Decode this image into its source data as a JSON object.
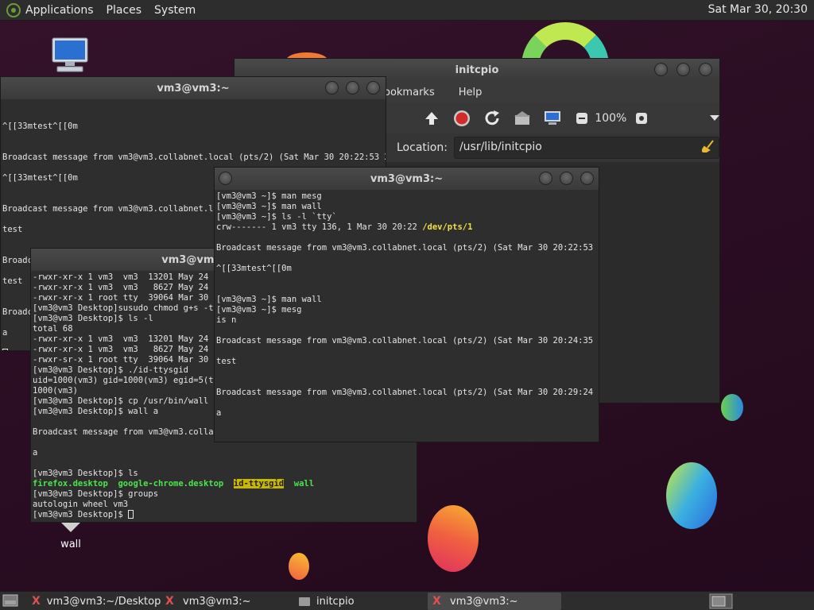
{
  "top_panel": {
    "menus": [
      "Applications",
      "Places",
      "System"
    ],
    "clock": "Sat Mar 30, 20:30"
  },
  "desktop_icons": {
    "wall_label": "wall"
  },
  "file_manager": {
    "title": "initcpio",
    "menu_bookmarks": "ookmarks",
    "menu_help": "Help",
    "zoom": "100%",
    "location_label": "Location:",
    "location_value": "/usr/lib/initcpio"
  },
  "term_back": {
    "title": "vm3@vm3:~",
    "lines": [
      "",
      "",
      "^[[33mtest^[[0m",
      "",
      "",
      "Broadcast message from vm3@vm3.collabnet.local (pts/2) (Sat Mar 30 20:22:53 202",
      "",
      "^[[33mtest^[[0m",
      "",
      "",
      "Broadcast message from vm3@vm3.collabnet.local (pts/2) (Sat Mar 30 20:24:35 202",
      "",
      "test",
      "",
      "",
      "Broadcast message from vm3@vm3.collabnet.local (pts/2) (Sat Mar 30 20:29:24 202",
      "",
      "test",
      "",
      "",
      "Broadcast message from vm3@vm3.collabnet.local (pts/2) (Sat Mar 30 20:29:24 202",
      "",
      "a",
      ""
    ]
  },
  "term_desktop": {
    "title": "vm3@vm3:~/Desktop",
    "lines": [
      "-rwxr-xr-x 1 vm3  vm3  13201 May 24  20",
      "-rwxr-xr-x 1 vm3  vm3   8627 May 24  20",
      "-rwxr-xr-x 1 root tty  39064 Mar 30 20:",
      "[vm3@vm3 Desktop]susudo chmod g+s -tty",
      "[vm3@vm3 Desktop]$ ls -l",
      "total 68",
      "-rwxr-xr-x 1 vm3  vm3  13201 May 24  20",
      "-rwxr-xr-x 1 vm3  vm3   8627 May 24  20",
      "-rwxr-sr-x 1 root tty  39064 Mar 30 20:",
      "[vm3@vm3 Desktop]$ ./id-ttysgid",
      "uid=1000(vm3) gid=1000(vm3) egid=5(tty",
      "1000(vm3)",
      "[vm3@vm3 Desktop]$ cp /usr/bin/wall .",
      "[vm3@vm3 Desktop]$ wall a",
      "",
      "Broadcast message from vm3@vm3.collabn",
      "",
      "a",
      "",
      "[vm3@vm3 Desktop]$ ls"
    ],
    "ls_files": [
      "firefox.desktop",
      "google-chrome.desktop",
      "id-ttysgid",
      "wall"
    ],
    "after_lines": [
      "[vm3@vm3 Desktop]$ groups",
      "autologin wheel vm3"
    ],
    "prompt": "[vm3@vm3 Desktop]$ "
  },
  "term_front": {
    "title": "vm3@vm3:~",
    "lines_a": [
      "[vm3@vm3 ~]$ man mesg",
      "[vm3@vm3 ~]$ man wall",
      "[vm3@vm3 ~]$ ls -l `tty`"
    ],
    "ls_line": "crw------- 1 vm3 tty 136, 1 Mar 30 20:22 ",
    "ls_path": "/dev/pts/1",
    "lines_b": [
      "",
      "Broadcast message from vm3@vm3.collabnet.local (pts/2) (Sat Mar 30 20:22:53 202",
      "",
      "^[[33mtest^[[0m",
      "",
      "",
      "[vm3@vm3 ~]$ man wall",
      "[vm3@vm3 ~]$ mesg",
      "is n",
      "",
      "Broadcast message from vm3@vm3.collabnet.local (pts/2) (Sat Mar 30 20:24:35 202",
      "",
      "test",
      "",
      "",
      "Broadcast message from vm3@vm3.collabnet.local (pts/2) (Sat Mar 30 20:29:24 202",
      "",
      "a",
      ""
    ]
  },
  "taskbar": {
    "tasks": [
      "vm3@vm3:~/Desktop",
      "vm3@vm3:~",
      "initcpio",
      "vm3@vm3:~"
    ]
  }
}
